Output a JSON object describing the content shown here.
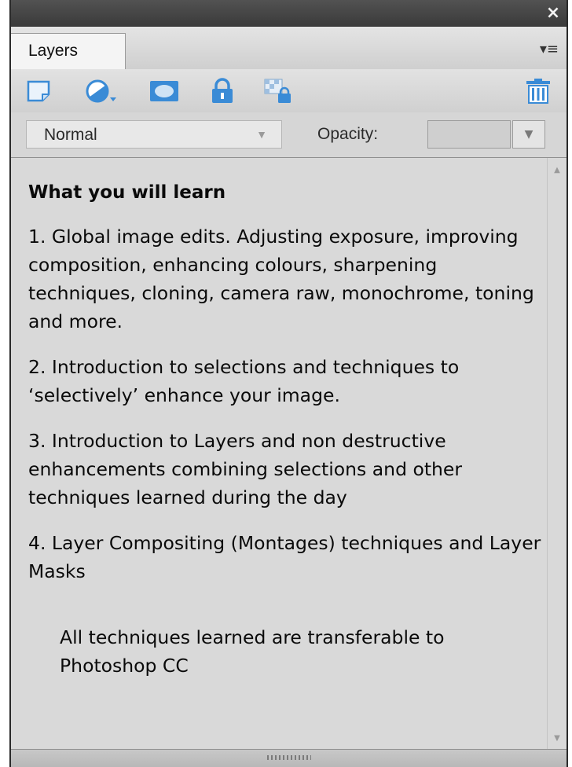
{
  "window": {
    "close_symbol": "×"
  },
  "tabs": {
    "layers_label": "Layers",
    "menu_symbol": "▾≡"
  },
  "toolbar": {
    "icons": [
      "new-layer-icon",
      "adjustment-layer-icon",
      "layer-mask-icon",
      "lock-all-icon",
      "lock-transparency-icon",
      "trash-icon"
    ]
  },
  "blend": {
    "mode": "Normal",
    "opacity_label": "Opacity:",
    "opacity_value": ""
  },
  "content": {
    "heading": "What you will learn",
    "items": [
      "1. Global image edits. Adjusting exposure, improving composition, enhancing colours, sharpening techniques, cloning, camera raw, monochrome, toning and more.",
      "2. Introduction to selections and techniques to ‘selectively’ enhance your image.",
      "3. Introduction to Layers and non destructive enhancements combining selections and other techniques learned during the day",
      "4. Layer Compositing (Montages) techniques and Layer Masks"
    ],
    "note": "All techniques learned are transferable to Photoshop CC"
  },
  "colors": {
    "panel_bg": "#d6d6d6",
    "titlebar": "#3a3a3a",
    "icon_blue": "#3a8bd6"
  }
}
